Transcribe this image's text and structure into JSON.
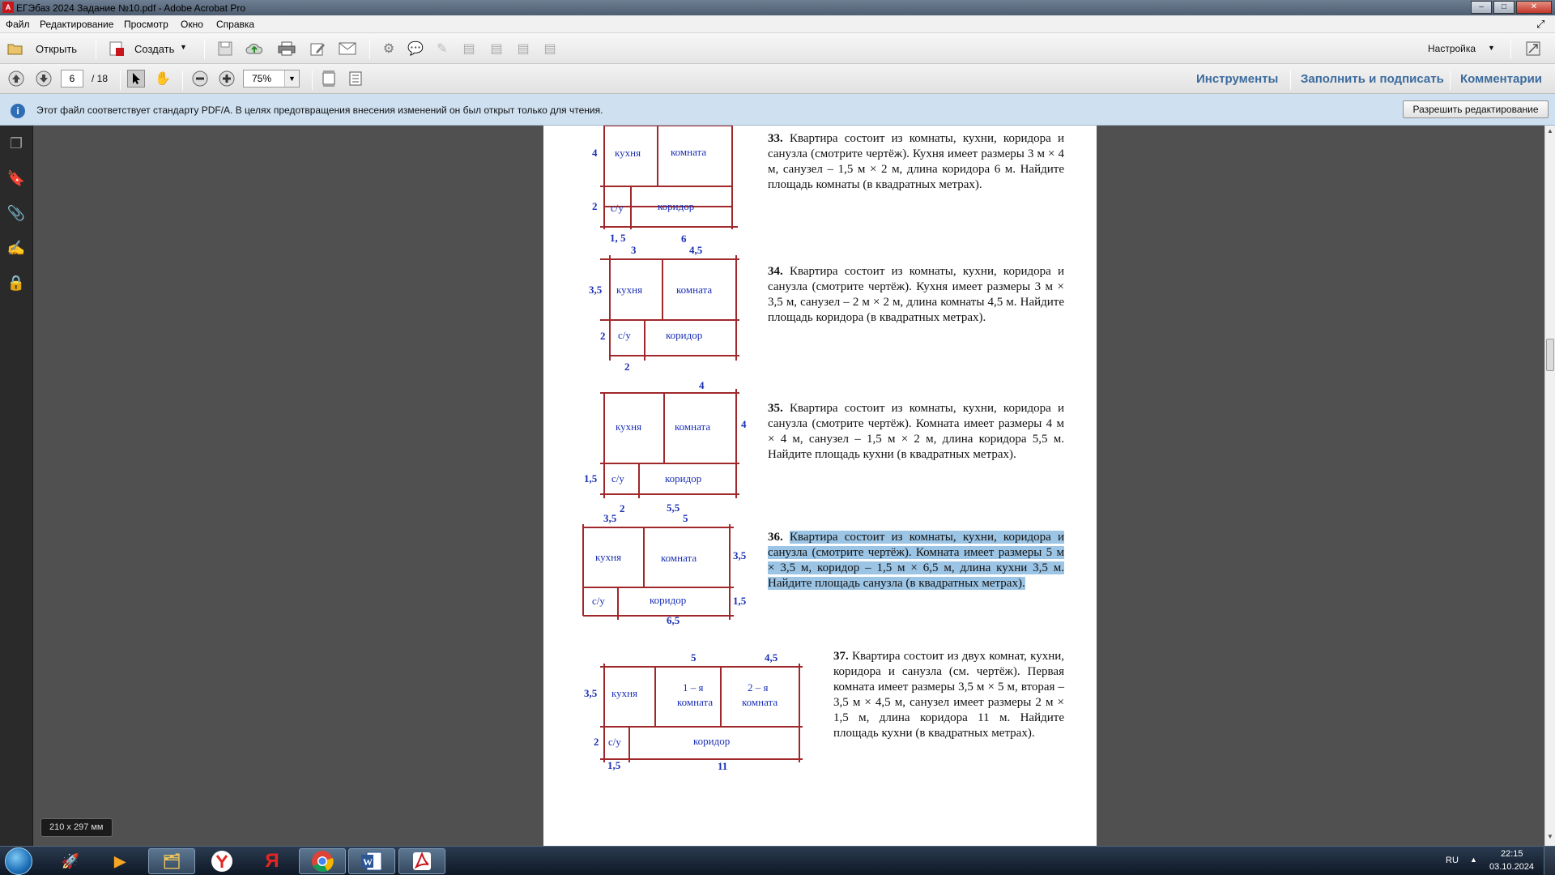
{
  "window": {
    "title": "ЕГЭбаз 2024 Задание №10.pdf - Adobe Acrobat Pro",
    "app_icon": "acrobat-icon",
    "buttons": [
      "–",
      "□",
      "✕"
    ]
  },
  "menu": [
    "Файл",
    "Редактирование",
    "Просмотр",
    "Окно",
    "Справка"
  ],
  "toolbar": {
    "open": "Открыть",
    "create": "Создать",
    "settings": "Настройка"
  },
  "nav": {
    "page": "6",
    "total": "/ 18",
    "zoom": "75%",
    "tools": "Инструменты",
    "fill_sign": "Заполнить и подписать",
    "comments": "Комментарии"
  },
  "info": {
    "text": "Этот файл соответствует стандарту PDF/A. В целях предотвращения внесения изменений он был открыт только для чтения.",
    "button": "Разрешить редактирование"
  },
  "size_tip": "210 x 297 мм",
  "tasks": [
    {
      "num": "33.",
      "text": "Квартира состоит из комнаты, кухни, коридора и санузла (смотрите чертёж). Кухня имеет размеры 3 м × 4 м, санузел – 1,5 м × 2 м, длина коридора 6 м. Найдите площадь комнаты (в квадратных метрах)."
    },
    {
      "num": "34.",
      "text": "Квартира состоит из комнаты, кухни, коридора и санузла (смотрите чертёж). Кухня имеет размеры 3 м × 3,5 м, санузел – 2 м × 2 м, длина комнаты 4,5 м. Найдите площадь коридора (в квадратных метрах)."
    },
    {
      "num": "35.",
      "text": "Квартира состоит из комнаты, кухни, коридора и санузла (смотрите чертёж). Комната имеет размеры 4 м × 4 м, санузел – 1,5 м × 2 м, длина коридора 5,5 м. Найдите площадь кухни (в квадратных метрах)."
    },
    {
      "num": "36.",
      "text": "Квартира состоит из комнаты, кухни, коридора и санузла (смотрите чертёж). Комната имеет размеры 5 м × 3,5 м, коридор – 1,5 м × 6,5 м, длина кухни 3,5 м. Найдите площадь санузла (в квадратных метрах)."
    },
    {
      "num": "37.",
      "text": "Квартира состоит из двух комнат, кухни, коридора и санузла (см. чертёж). Первая комната имеет размеры 3,5 м × 5 м, вторая – 3,5 м × 4,5 м, санузел имеет размеры 2 м × 1,5 м, длина коридора 11 м. Найдите площадь кухни (в квадратных метрах)."
    }
  ],
  "labels": {
    "kitchen": "кухня",
    "room": "комната",
    "wc": "с/у",
    "corridor": "коридор",
    "room1a": "1 – я",
    "room2a": "2 – я"
  },
  "dims": {
    "d33": [
      "4",
      "2",
      "1, 5",
      "6"
    ],
    "d34": [
      "3",
      "4,5",
      "3,5",
      "2",
      "2"
    ],
    "d35": [
      "4",
      "4",
      "1,5",
      "2",
      "5,5"
    ],
    "d36": [
      "3,5",
      "5",
      "3,5",
      "1,5",
      "6,5"
    ],
    "d37": [
      "5",
      "4,5",
      "3,5",
      "2",
      "1,5",
      "11"
    ]
  },
  "tray": {
    "lang": "RU",
    "time": "22:15",
    "date": "03.10.2024"
  },
  "colors": {
    "plan_line": "#a0282a",
    "plan_text": "#1a2fb5",
    "highlight": "#9cc4e4"
  }
}
